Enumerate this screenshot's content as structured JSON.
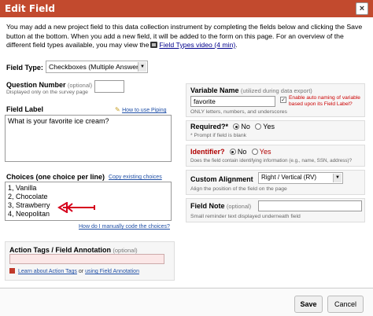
{
  "dialog": {
    "title": "Edit Field",
    "close_glyph": "×"
  },
  "intro": {
    "line1": "You may add a new project field to this data collection instrument by completing the fields below and clicking the Save",
    "line2": "button at the bottom. When you add a new field, it will be added to the form on this page. For an overview of the",
    "line3_prefix": "different field types available, you may view the",
    "video_link": "Field Types video (4 min)",
    "line3_suffix": "."
  },
  "field_type": {
    "label": "Field Type:",
    "value": "Checkboxes (Multiple Answers)"
  },
  "question_number": {
    "label": "Question Number",
    "optional": "(optional)",
    "hint": "Displayed only on the survey page",
    "value": ""
  },
  "field_label": {
    "label": "Field Label",
    "piping_link": "How to use Piping",
    "value": "What is your favorite ice cream?"
  },
  "choices": {
    "label": "Choices (one choice per line)",
    "copy_link": "Copy existing choices",
    "items": [
      "1, Vanilla",
      "2, Chocolate",
      "3, Strawberry",
      "4, Neopolitan"
    ],
    "manual_code_link": "How do I manually code the choices?"
  },
  "action_tags": {
    "label": "Action Tags / Field Annotation",
    "optional": "(optional)",
    "value": "",
    "learn_link": "Learn about Action Tags",
    "or_text": "or",
    "annotation_link": "using Field Annotation"
  },
  "variable_name": {
    "label": "Variable Name",
    "hint_inline": "(utilized during data export)",
    "value": "favorite",
    "rule": "ONLY letters, numbers, and underscores",
    "auto_naming": "Enable auto naming of variable based upon its Field Label?",
    "auto_naming_checked": true
  },
  "required": {
    "label": "Required?*",
    "no": "No",
    "yes": "Yes",
    "selected": "No",
    "hint": "* Prompt if field is blank"
  },
  "identifier": {
    "label": "Identifier?",
    "no": "No",
    "yes": "Yes",
    "selected": "No",
    "hint": "Does the field contain identifying information (e.g., name, SSN, address)?"
  },
  "custom_alignment": {
    "label": "Custom Alignment",
    "value": "Right / Vertical (RV)",
    "hint": "Align the position of the field on the page"
  },
  "field_note": {
    "label": "Field Note",
    "optional": "(optional)",
    "value": "",
    "hint": "Small reminder text displayed underneath field"
  },
  "footer": {
    "save": "Save",
    "cancel": "Cancel"
  },
  "colors": {
    "title_bar": "#c24a2e",
    "link": "#1f4fa6",
    "annotation_arrow": "#d6001c",
    "identifier_label": "#b00000"
  },
  "icons": [
    "close-icon",
    "film-icon",
    "pencil-icon",
    "dropdown-arrow-icon",
    "red-arrow-annotation",
    "action-tag-icon"
  ]
}
